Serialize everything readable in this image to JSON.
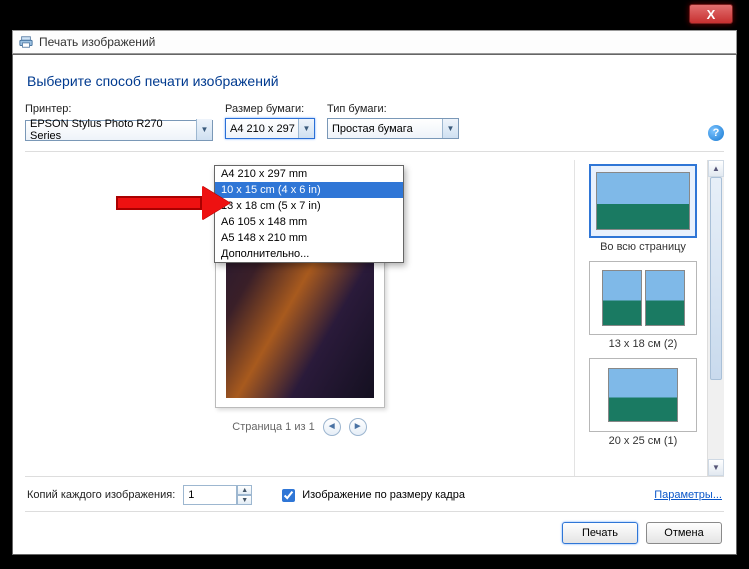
{
  "chrome": {
    "close_glyph": "X"
  },
  "title": {
    "text": "Печать изображений"
  },
  "header": "Выберите способ печати изображений",
  "labels": {
    "printer": "Принтер:",
    "paper_size": "Размер бумаги:",
    "paper_type": "Тип бумаги:"
  },
  "printer": {
    "selected": "EPSON Stylus Photo R270 Series"
  },
  "paper_size": {
    "selected": "A4 210 x 297",
    "options": [
      "A4 210 x 297 mm",
      "10 x 15 cm (4 x 6 in)",
      "13 x 18 cm (5 x 7 in)",
      "A6 105 x 148 mm",
      "A5 148 x 210 mm",
      "Дополнительно..."
    ],
    "highlighted_index": 1
  },
  "paper_type": {
    "selected": "Простая бумага"
  },
  "pager": {
    "text": "Страница 1 из 1"
  },
  "layouts": [
    {
      "label": "Во всю страницу",
      "kind": "full",
      "selected": true
    },
    {
      "label": "13 x 18 см (2)",
      "kind": "pair",
      "selected": false
    },
    {
      "label": "20 x 25 см (1)",
      "kind": "single",
      "selected": false
    }
  ],
  "copies": {
    "label": "Копий каждого изображения:",
    "value": "1"
  },
  "fit": {
    "label": "Изображение по размеру кадра",
    "checked": true
  },
  "links": {
    "params": "Параметры..."
  },
  "buttons": {
    "print": "Печать",
    "cancel": "Отмена"
  },
  "help_glyph": "?"
}
